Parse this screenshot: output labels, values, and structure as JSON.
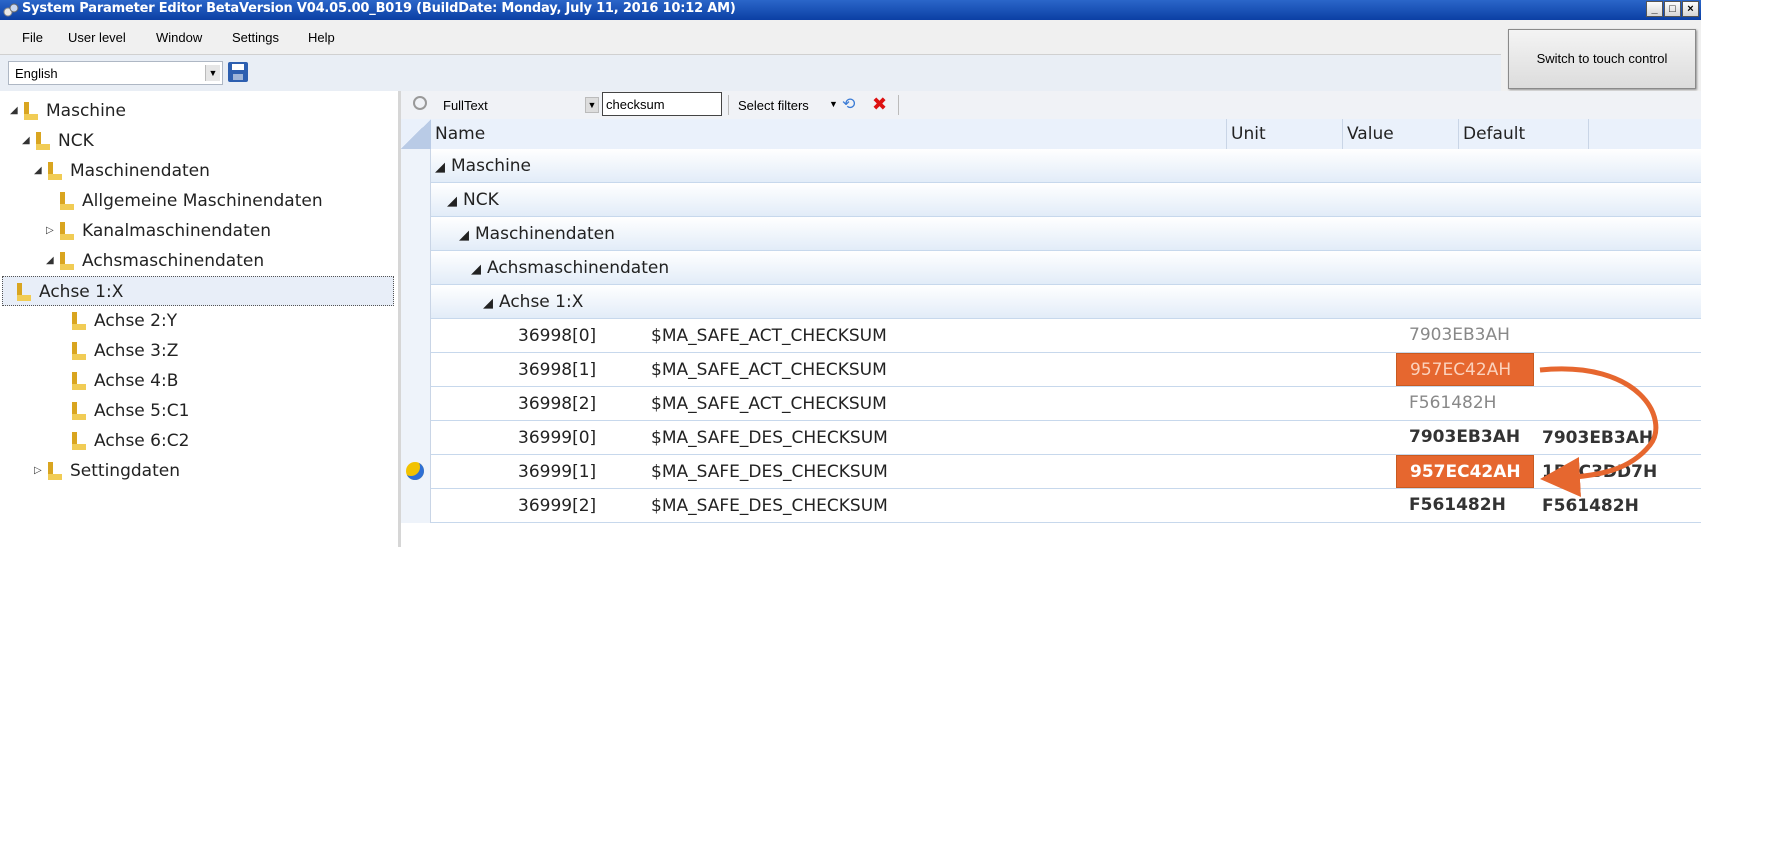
{
  "window": {
    "title": "System Parameter Editor BetaVersion V04.05.00_B019 (BuildDate: Monday, July 11, 2016 10:12 AM)"
  },
  "menu": [
    "File",
    "User level",
    "Window",
    "Settings",
    "Help"
  ],
  "touch_button": "Switch to touch control",
  "language": {
    "value": "English"
  },
  "tree": [
    {
      "label": "Maschine",
      "depth": 0,
      "expander": "expanded"
    },
    {
      "label": "NCK",
      "depth": 1,
      "expander": "expanded"
    },
    {
      "label": "Maschinendaten",
      "depth": 2,
      "expander": "expanded"
    },
    {
      "label": "Allgemeine Maschinendaten",
      "depth": 3,
      "expander": "none"
    },
    {
      "label": "Kanalmaschinendaten",
      "depth": 3,
      "expander": "collapsed"
    },
    {
      "label": "Achsmaschinendaten",
      "depth": 3,
      "expander": "expanded"
    },
    {
      "label": "Achse 1:X",
      "depth": 4,
      "expander": "none",
      "selected": true
    },
    {
      "label": "Achse 2:Y",
      "depth": 4,
      "expander": "none"
    },
    {
      "label": "Achse 3:Z",
      "depth": 4,
      "expander": "none"
    },
    {
      "label": "Achse 4:B",
      "depth": 4,
      "expander": "none"
    },
    {
      "label": "Achse 5:C1",
      "depth": 4,
      "expander": "none"
    },
    {
      "label": "Achse 6:C2",
      "depth": 4,
      "expander": "none"
    },
    {
      "label": "Settingdaten",
      "depth": 2,
      "expander": "collapsed"
    }
  ],
  "filter": {
    "mode": "FullText",
    "search": "checksum",
    "select_filters": "Select filters"
  },
  "columns": {
    "name": "Name",
    "unit": "Unit",
    "value": "Value",
    "default": "Default"
  },
  "groups": [
    {
      "label": "Maschine",
      "level": 0
    },
    {
      "label": "NCK",
      "level": 1
    },
    {
      "label": "Maschinendaten",
      "level": 2
    },
    {
      "label": "Achsmaschinendaten",
      "level": 3
    },
    {
      "label": "Achse 1:X",
      "level": 4
    }
  ],
  "rows": [
    {
      "id": "36998[0]",
      "name": "$MA_SAFE_ACT_CHECKSUM",
      "value": "7903EB3AH",
      "default": "",
      "style": "gray"
    },
    {
      "id": "36998[1]",
      "name": "$MA_SAFE_ACT_CHECKSUM",
      "value": "957EC42AH",
      "default": "",
      "style": "hl-dim"
    },
    {
      "id": "36998[2]",
      "name": "$MA_SAFE_ACT_CHECKSUM",
      "value": "F561482H",
      "default": "",
      "style": "gray"
    },
    {
      "id": "36999[0]",
      "name": "$MA_SAFE_DES_CHECKSUM",
      "value": "7903EB3AH",
      "default": "7903EB3AH",
      "style": "bold"
    },
    {
      "id": "36999[1]",
      "name": "$MA_SAFE_DES_CHECKSUM",
      "value": "957EC42AH",
      "default": "1B4C3DD7H",
      "style": "hl",
      "marker": "warning-icon"
    },
    {
      "id": "36999[2]",
      "name": "$MA_SAFE_DES_CHECKSUM",
      "value": "F561482H",
      "default": "F561482H",
      "style": "bold"
    }
  ],
  "colors": {
    "highlight": "#e6672f",
    "titlebar": "#1450b8",
    "arrow": "#e6672f"
  }
}
